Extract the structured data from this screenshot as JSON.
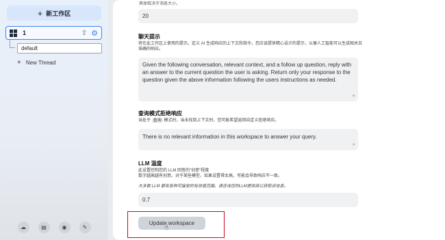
{
  "sidebar": {
    "new_workspace_label": "新工作区",
    "workspace_name": "1",
    "thread_name": "default",
    "new_thread_label": "New Thread"
  },
  "main": {
    "top_fragment": "具体取决于消息大小。",
    "history_value": "20",
    "chat_prompt": {
      "title": "聊天提示",
      "desc": "将在此工作区上使用的提示。定义 AI 生成响应的上下文和指令。您应该提供精心设计的提示，以便人工智能可以生成相关且准确的响应。",
      "value": "Given the following conversation, relevant context, and a follow up question, reply with an answer to the current question the user is asking. Return only your response to the question given the above information following the users instructions as needed."
    },
    "refusal": {
      "title": "查询模式拒绝响应",
      "desc_before": "当处于",
      "desc_tag": "查询",
      "desc_after": "模式时，当未找到上下文时，您可能希望返回自定义拒绝响应。",
      "value": "There is no relevant information in this workspace to answer your query."
    },
    "temperature": {
      "title": "LLM 温度",
      "desc_line1": "此设置控制您的 LLM 回答的\"创意\"程度",
      "desc_line2": "数字越高越有创意。对于某些模型，如果设置得太高，可能会导致响应不一致。",
      "note": "大多数 LLM 都有各种可接受的有效值范围。请咨询您的LLM提供商以获取该信息。",
      "value": "0.7"
    },
    "update_button_label": "Update workspace"
  },
  "icons": {
    "footer": [
      "cloud-icon",
      "book-icon",
      "discord-icon",
      "wrench-icon"
    ]
  }
}
